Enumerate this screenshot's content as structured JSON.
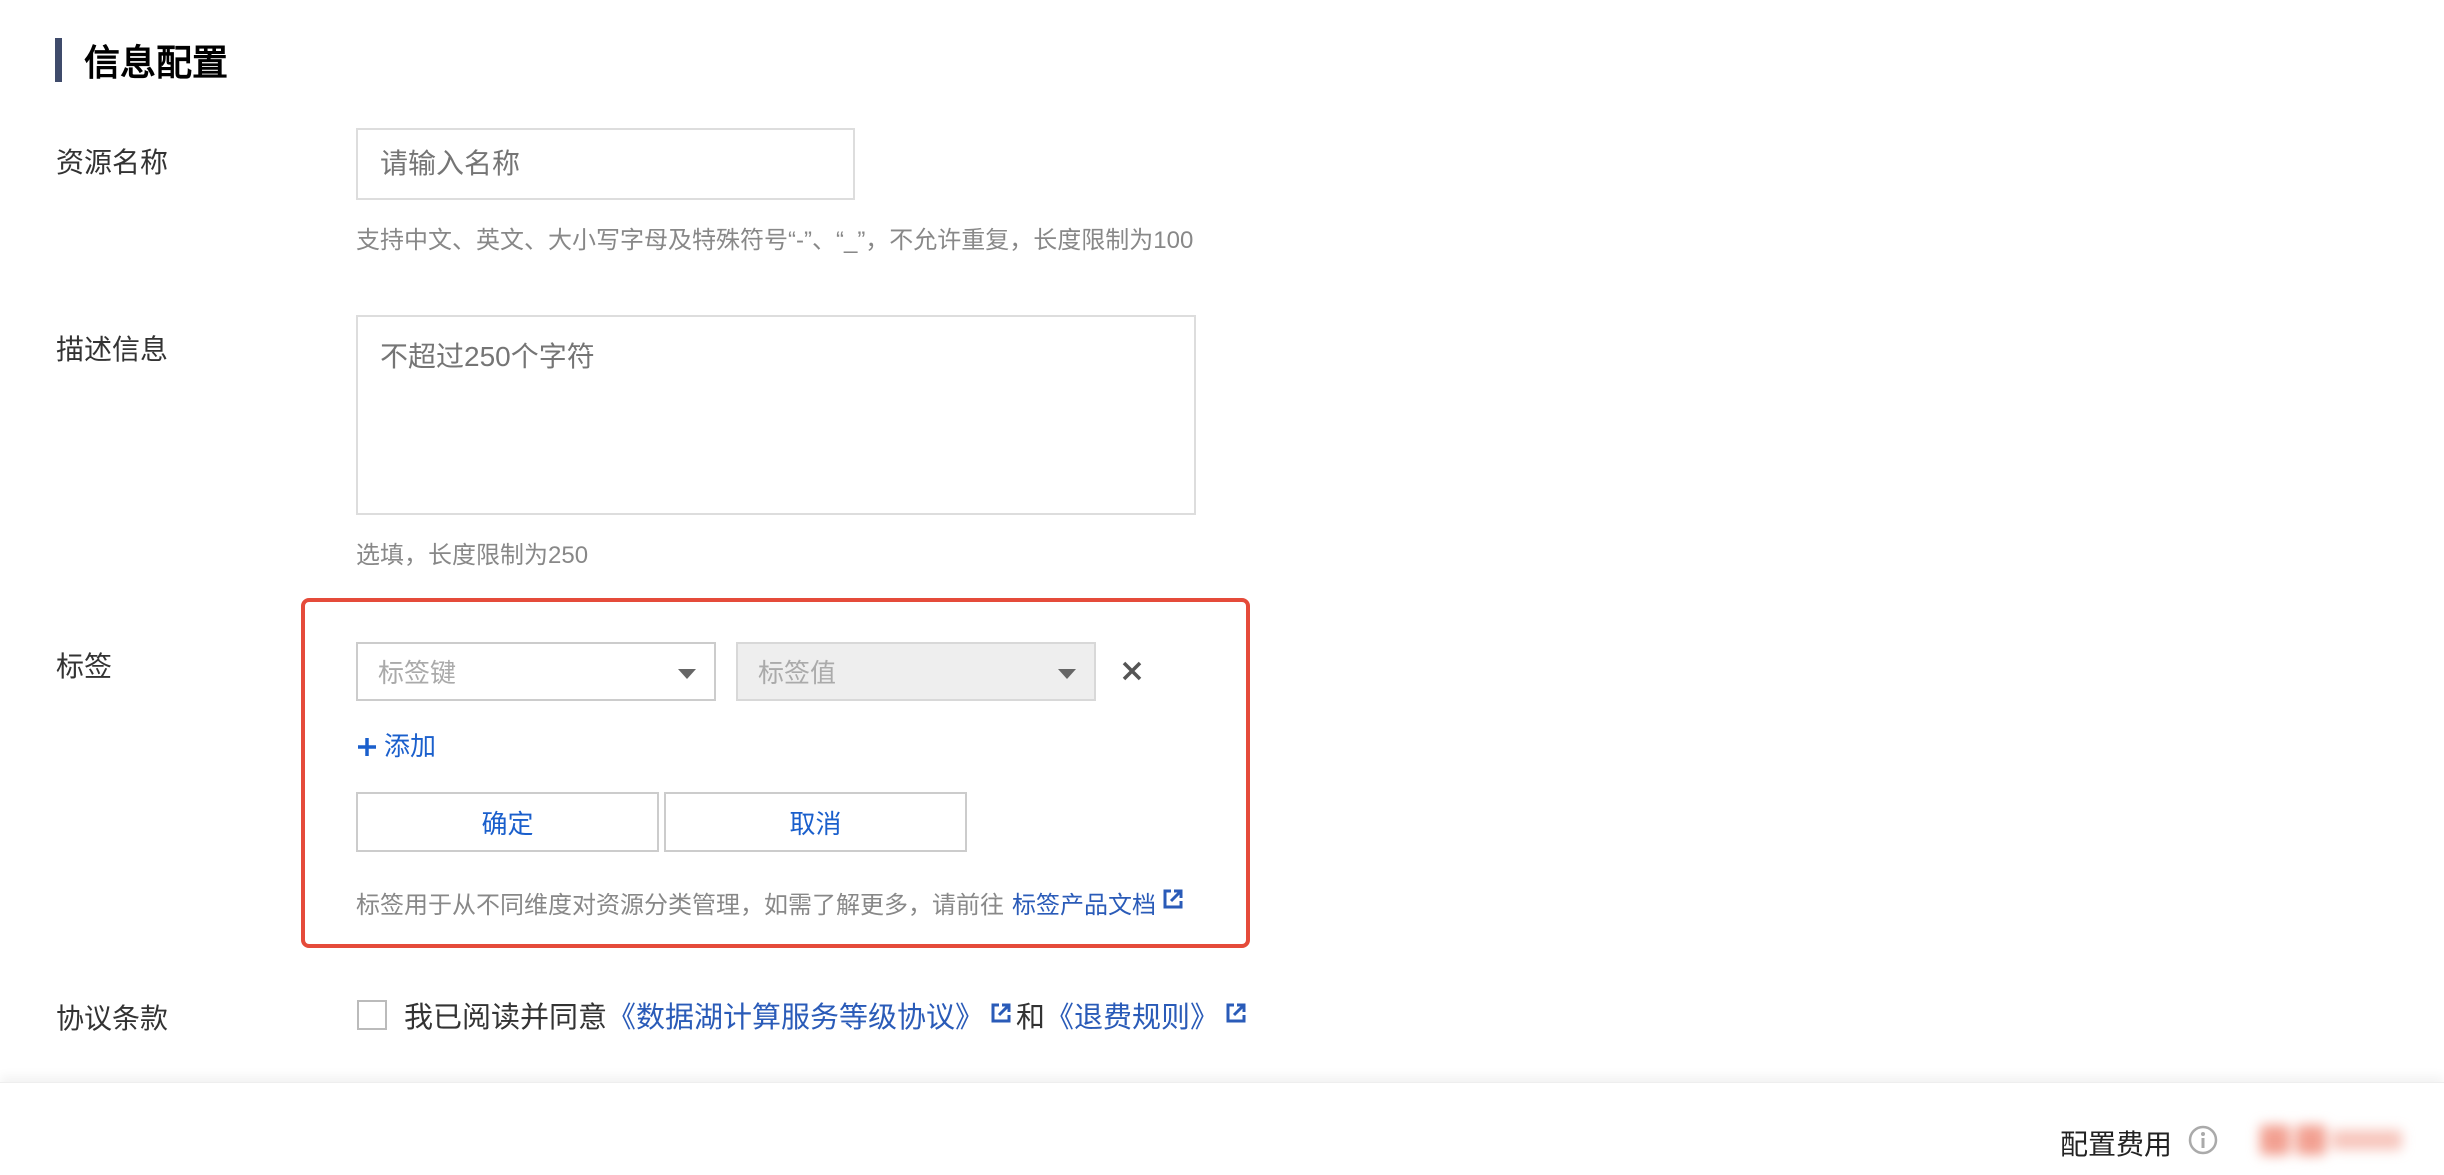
{
  "section": {
    "title": "信息配置"
  },
  "resource_name": {
    "label": "资源名称",
    "placeholder": "请输入名称",
    "hint": "支持中文、英文、大小写字母及特殊符号“-”、“_”，不允许重复，长度限制为100"
  },
  "description": {
    "label": "描述信息",
    "placeholder": "不超过250个字符",
    "hint": "选填，长度限制为250"
  },
  "tags": {
    "label": "标签",
    "key_placeholder": "标签键",
    "value_placeholder": "标签值",
    "remove_icon": "close-icon",
    "add_label": "添加",
    "confirm_label": "确定",
    "cancel_label": "取消",
    "hint_text": "标签用于从不同维度对资源分类管理，如需了解更多，请前往",
    "doc_link": "标签产品文档"
  },
  "agreement": {
    "label": "协议条款",
    "prefix": "我已阅读并同意",
    "sla_link": "《数据湖计算服务等级协议》",
    "conjunction": "和",
    "refund_link": "《退费规则》",
    "checked": false
  },
  "footer": {
    "fee_label": "配置费用"
  },
  "colors": {
    "accent": "#1a5fcc",
    "link": "#2a5bb8",
    "highlight_border": "#e54b3a",
    "section_bar": "#3f4b6b"
  }
}
